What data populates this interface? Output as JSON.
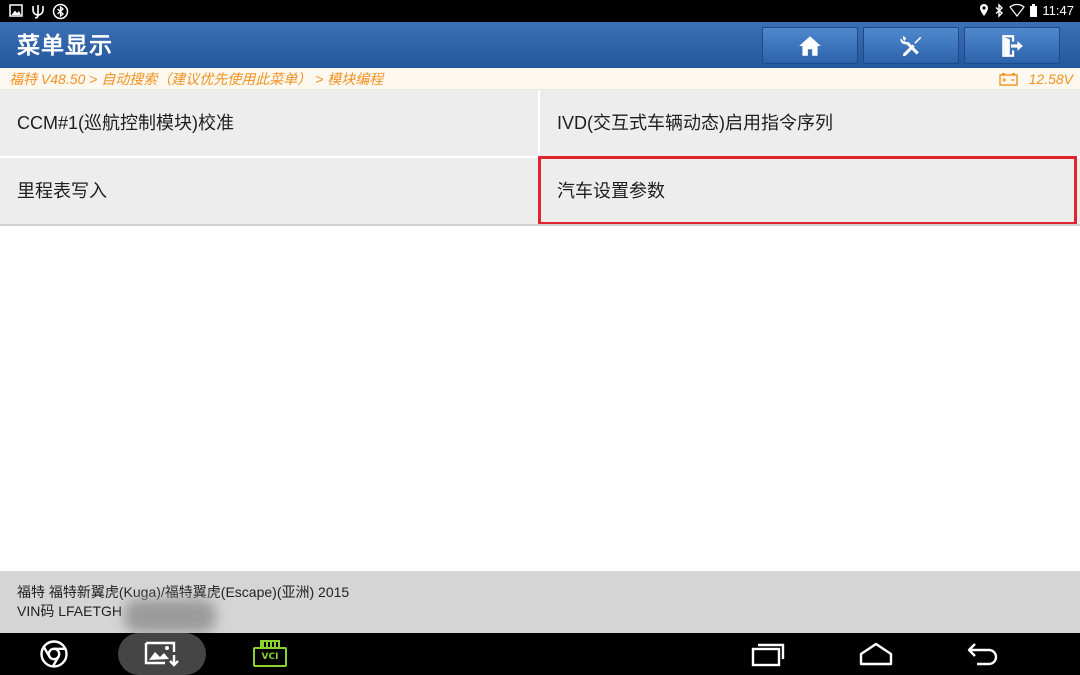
{
  "colors": {
    "status_bar_bg": "#000000",
    "header_top": "#3c70b6",
    "header_bottom": "#25579c",
    "breadcrumb_text": "#f39121",
    "menu_cell_bg": "#ededed",
    "selected_border": "#e1242b",
    "footer_bg": "#d5d5d5",
    "nav_bar_bg": "#000000",
    "vci_green": "#8bd22f"
  },
  "status_bar": {
    "left_icons": [
      "picture-icon",
      "usb-debug-icon",
      "bluetooth-circle-icon"
    ],
    "right_icons": [
      "location-icon",
      "bluetooth-icon",
      "wifi-icon",
      "battery-icon"
    ],
    "time": "11:47"
  },
  "header": {
    "title": "菜单显示",
    "buttons": [
      {
        "icon": "home-icon"
      },
      {
        "icon": "tools-icon"
      },
      {
        "icon": "exit-icon"
      }
    ]
  },
  "breadcrumb": {
    "path": "福特 V48.50 > 自动搜索（建议优先使用此菜单） > 模块编程",
    "battery_icon": "car-battery-icon",
    "voltage": "12.58V"
  },
  "menu": {
    "items": [
      {
        "label": "CCM#1(巡航控制模块)校准",
        "selected": false
      },
      {
        "label": "IVD(交互式车辆动态)启用指令序列",
        "selected": false
      },
      {
        "label": "里程表写入",
        "selected": false
      },
      {
        "label": "汽车设置参数",
        "selected": true
      }
    ]
  },
  "footer": {
    "vehicle": "福特 福特新翼虎(Kuga)/福特翼虎(Escape)(亚洲) 2015",
    "vin": "VIN码 LFAETGH"
  },
  "nav_bar": {
    "icons": [
      "browser-icon",
      "screenshot-icon",
      "vci-icon",
      "recent-apps-icon",
      "home-outline-icon",
      "back-icon"
    ],
    "vci_label": "VCI"
  }
}
